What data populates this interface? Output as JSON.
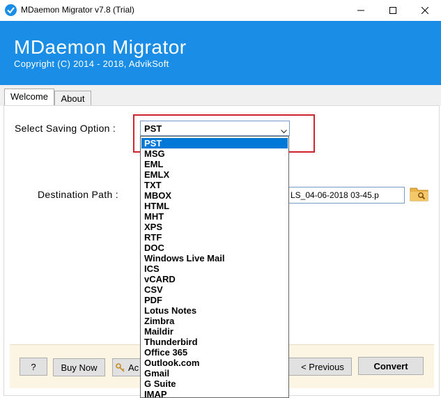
{
  "window": {
    "title": "MDaemon Migrator v7.8 (Trial)"
  },
  "header": {
    "title": "MDaemon Migrator",
    "subtitle": "Copyright (C) 2014 - 2018,  AdvikSoft"
  },
  "tabs": [
    {
      "label": "Welcome",
      "active": true
    },
    {
      "label": "About",
      "active": false
    }
  ],
  "form": {
    "saving_label": "Select Saving Option :",
    "saving_value": "PST",
    "dest_label": "Destination Path :",
    "dest_value": "LS_04-06-2018 03-45.p"
  },
  "dropdown": {
    "options": [
      "PST",
      "MSG",
      "EML",
      "EMLX",
      "TXT",
      "MBOX",
      "HTML",
      "MHT",
      "XPS",
      "RTF",
      "DOC",
      "Windows Live Mail",
      "ICS",
      "vCARD",
      "CSV",
      "PDF",
      "Lotus Notes",
      "Zimbra",
      "Maildir",
      "Thunderbird",
      "Office 365",
      "Outlook.com",
      "Gmail",
      "G Suite",
      "IMAP"
    ],
    "selected_index": 0
  },
  "footer": {
    "help_label": "?",
    "buy_label": "Buy Now",
    "activate_label": "Ac",
    "previous_label": "< Previous",
    "convert_label": "Convert"
  },
  "colors": {
    "header_bg": "#1a8ee6",
    "highlight": "#d1232b",
    "selection": "#0078d7",
    "footer_bg": "#fdf5e4"
  }
}
